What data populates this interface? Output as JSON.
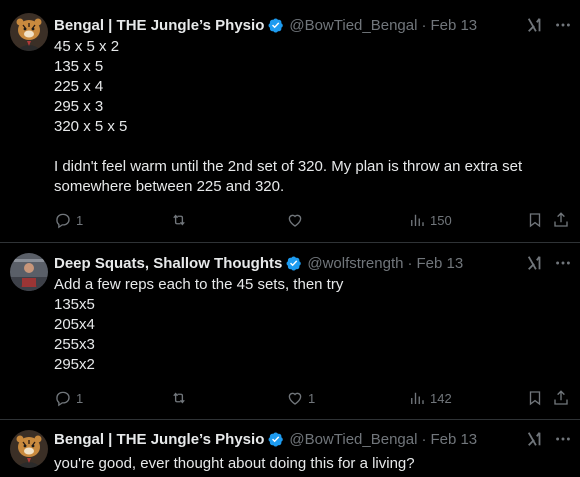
{
  "icons": {
    "verified": "verified-badge-icon",
    "grok": "grok-icon",
    "more": "more-dots-icon",
    "reply": "reply-icon",
    "retweet": "retweet-icon",
    "like": "like-heart-icon",
    "views": "views-chart-icon",
    "bookmark": "bookmark-icon",
    "share": "share-icon"
  },
  "colors": {
    "background": "#000000",
    "text": "#e7e9ea",
    "muted": "#71767b",
    "verified": "#1d9bf0",
    "divider": "#2f3336"
  },
  "tweets": [
    {
      "display_name": "Bengal | THE Jungle’s Physio",
      "handle": "@BowTied_Bengal",
      "separator": "·",
      "date": "Feb 13",
      "lines": [
        "45 x 5 x 2",
        "135 x 5",
        "225 x 4",
        "295 x 3",
        "320 x 5 x 5",
        "",
        "I didn't feel warm until the 2nd set of 320. My plan is throw an extra set",
        "somewhere between 225 and 320."
      ],
      "reply_count": "1",
      "retweet_count": "",
      "like_count": "",
      "view_count": "150"
    },
    {
      "display_name": "Deep Squats, Shallow Thoughts",
      "handle": "@wolfstrength",
      "separator": "·",
      "date": "Feb 13",
      "lines": [
        "Add a few reps each to the 45 sets, then try",
        "135x5",
        "205x4",
        "255x3",
        "295x2"
      ],
      "reply_count": "1",
      "retweet_count": "",
      "like_count": "1",
      "view_count": "142"
    },
    {
      "display_name": "Bengal | THE Jungle’s Physio",
      "handle": "@BowTied_Bengal",
      "separator": "·",
      "date": "Feb 13",
      "lines": [
        "you're good, ever thought about doing this for a living?"
      ]
    }
  ]
}
